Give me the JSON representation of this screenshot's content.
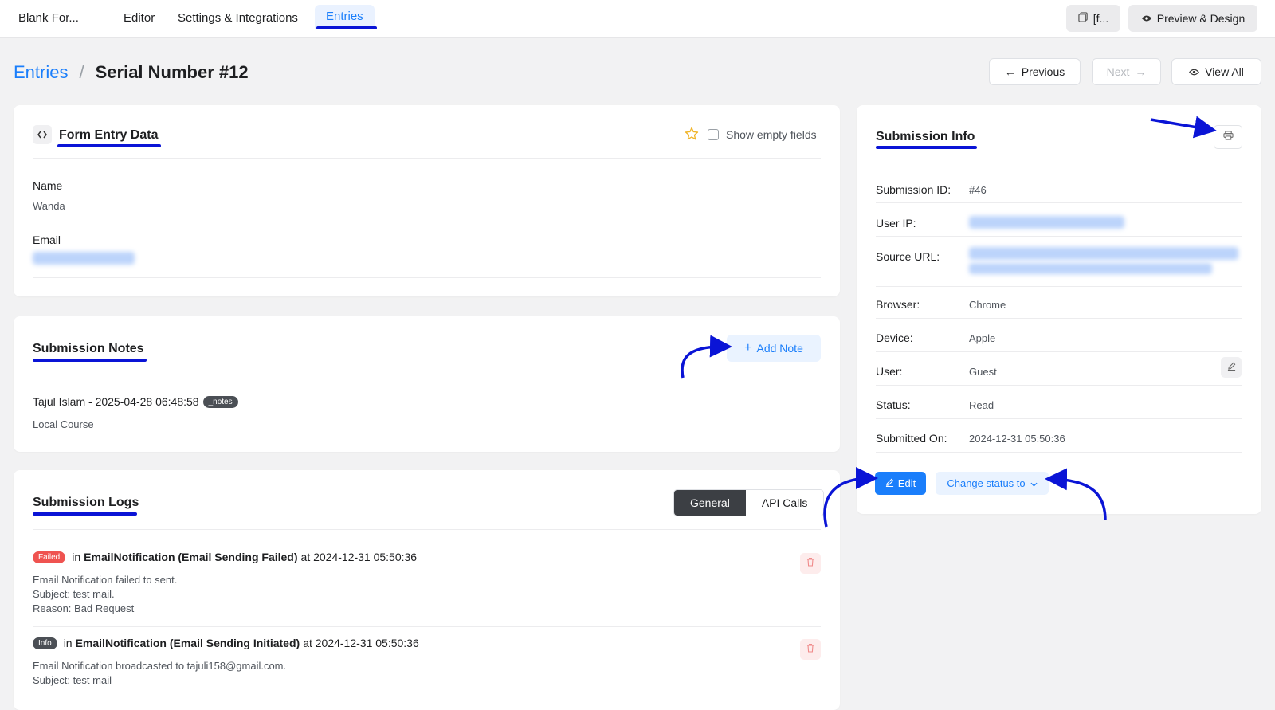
{
  "topbar": {
    "form_name": "Blank For...",
    "nav": [
      "Editor",
      "Settings & Integrations",
      "Entries"
    ],
    "shortcode_label": "[f...",
    "preview_label": "Preview & Design"
  },
  "header": {
    "breadcrumb_link": "Entries",
    "breadcrumb_sep": "/",
    "title": "Serial Number #12",
    "previous_label": "Previous",
    "next_label": "Next",
    "view_all_label": "View All"
  },
  "form_entry": {
    "title": "Form Entry Data",
    "show_empty_label": "Show empty fields",
    "fields": [
      {
        "label": "Name",
        "value": "Wanda"
      },
      {
        "label": "Email",
        "value": ""
      }
    ]
  },
  "notes": {
    "title": "Submission Notes",
    "add_label": "Add Note",
    "items": [
      {
        "author_time": "Tajul Islam - 2025-04-28 06:48:58",
        "tag": "_notes",
        "text": "Local Course"
      }
    ]
  },
  "logs": {
    "title": "Submission Logs",
    "tabs": [
      "General",
      "API Calls"
    ],
    "items": [
      {
        "badge": "Failed",
        "head_prefix": "in",
        "head_bold": "EmailNotification (Email Sending Failed)",
        "head_suffix": "at 2024-12-31 05:50:36",
        "lines": [
          "Email Notification failed to sent.",
          "Subject: test mail.",
          "Reason: Bad Request"
        ]
      },
      {
        "badge": "Info",
        "head_prefix": "in",
        "head_bold": "EmailNotification (Email Sending Initiated)",
        "head_suffix": "at 2024-12-31 05:50:36",
        "lines": [
          "Email Notification broadcasted to tajuli158@gmail.com.",
          "Subject: test mail"
        ]
      }
    ]
  },
  "submission_info": {
    "title": "Submission Info",
    "rows": [
      {
        "label": "Submission ID:",
        "value": "#46"
      },
      {
        "label": "User IP:",
        "value": ""
      },
      {
        "label": "Source URL:",
        "value": ""
      },
      {
        "label": "Browser:",
        "value": "Chrome"
      },
      {
        "label": "Device:",
        "value": "Apple"
      },
      {
        "label": "User:",
        "value": "Guest"
      },
      {
        "label": "Status:",
        "value": "Read"
      },
      {
        "label": "Submitted On:",
        "value": "2024-12-31 05:50:36"
      }
    ],
    "edit_label": "Edit",
    "change_status_label": "Change status to"
  },
  "colors": {
    "accent": "#1a7efb",
    "annotation": "#0a14d6",
    "failed": "#ef5350",
    "dark_tag": "#4b4f55"
  }
}
